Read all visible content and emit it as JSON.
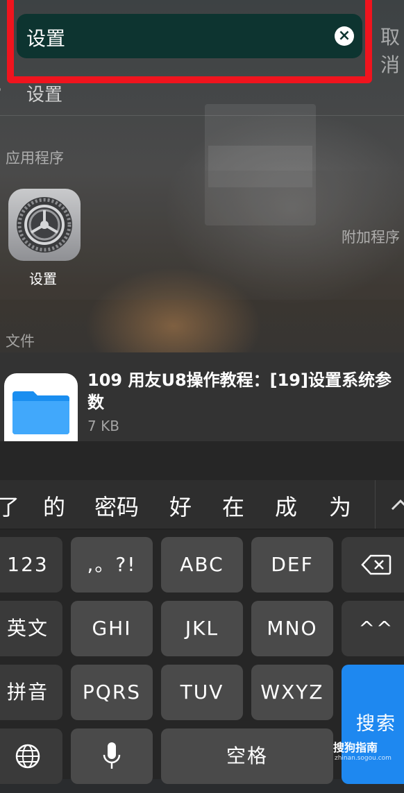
{
  "search": {
    "query": "设置",
    "clear_icon": "×",
    "cancel_label": "取消",
    "search_icon": "⌕"
  },
  "suggestion": {
    "text": "设置",
    "icon": "⌕"
  },
  "sections": {
    "apps": "应用程序",
    "files": "文件"
  },
  "app_result": {
    "name": "设置",
    "icon": "gear-icon"
  },
  "side_label": "附加程序",
  "file_result": {
    "title": "109 用友U8操作教程：[19]设置系统参数",
    "size": "7 KB",
    "icon": "folder-icon"
  },
  "candidates": [
    "了",
    "的",
    "密码",
    "好",
    "在",
    "成",
    "为"
  ],
  "keyboard": {
    "row1": [
      "123",
      ",。?!",
      "ABC",
      "DEF"
    ],
    "row2": [
      "英文",
      "GHI",
      "JKL",
      "MNO",
      "^^"
    ],
    "row3": [
      "拼音",
      "PQRS",
      "TUV",
      "WXYZ"
    ],
    "search_key": "搜索",
    "space": "空格",
    "backspace_icon": "⌫",
    "globe_icon": "globe-icon",
    "mic_icon": "mic-icon"
  },
  "watermark": {
    "text": "搜狗指南",
    "url": "zhinan.sogou.com"
  },
  "colors": {
    "highlight": "#f0141e",
    "search_key": "#1e88f0",
    "search_bar": "#0d3430"
  }
}
